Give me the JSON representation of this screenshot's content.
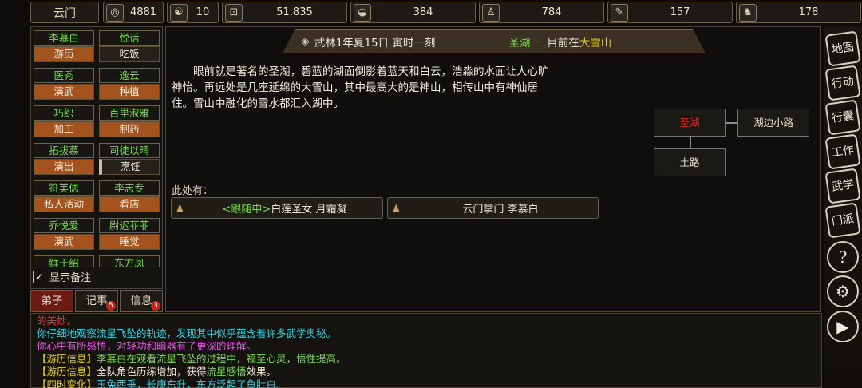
{
  "topbar": {
    "sect": "云门",
    "resources": [
      {
        "icon": "coin-pouch-icon",
        "glyph": "◎",
        "value": "4881"
      },
      {
        "icon": "yin-yang-icon",
        "glyph": "☯",
        "value": "10"
      },
      {
        "icon": "copper-coin-icon",
        "glyph": "⊡",
        "value": "51,835"
      },
      {
        "icon": "food-bowl-icon",
        "glyph": "◒",
        "value": "384"
      },
      {
        "icon": "herb-gourd-icon",
        "glyph": "♙",
        "value": "784"
      },
      {
        "icon": "scroll-icon",
        "glyph": "✎",
        "value": "157"
      },
      {
        "icon": "horse-icon",
        "glyph": "♞",
        "value": "178"
      }
    ]
  },
  "disciples": [
    {
      "name": "李慕白",
      "action": "游历",
      "style": "orange"
    },
    {
      "name": "悦话",
      "action": "吃饭",
      "style": "dark"
    },
    {
      "name": "医秀",
      "action": "演武",
      "style": "orange"
    },
    {
      "name": "逸云",
      "action": "种植",
      "style": "orange"
    },
    {
      "name": "巧织",
      "action": "加工",
      "style": "orange"
    },
    {
      "name": "百里淑雅",
      "action": "制药",
      "style": "orange"
    },
    {
      "name": "拓拔慕",
      "action": "演出",
      "style": "orange"
    },
    {
      "name": "司徒以晴",
      "action": "烹饪",
      "style": "dark"
    },
    {
      "name": "符美偲",
      "action": "私人活动",
      "style": "orange"
    },
    {
      "name": "李志专",
      "action": "看店",
      "style": "orange"
    },
    {
      "name": "乔悦爱",
      "action": "演武",
      "style": "orange"
    },
    {
      "name": "尉迟菲菲",
      "action": "睡觉",
      "style": "orange"
    },
    {
      "name": "鲜于绍",
      "action": "",
      "style": "orange"
    },
    {
      "name": "东方凤",
      "action": "",
      "style": "orange"
    }
  ],
  "show_notes_label": "显示备注",
  "tabs": [
    {
      "label": "弟子",
      "badge": ""
    },
    {
      "label": "记事",
      "badge": "5"
    },
    {
      "label": "信息",
      "badge": "3"
    }
  ],
  "location": {
    "date": "武林1年夏15日 寅时一刻",
    "place": "圣湖",
    "sep": "-",
    "current_prefix": "目前在",
    "region": "大雪山"
  },
  "description": "眼前就是著名的圣湖，碧蓝的湖面倒影着蓝天和白云，浩淼的水面让人心旷神怡。再远处是几座延绵的大雪山，其中最高大的是神山，相传山中有神仙居住。雪山中融化的雪水都汇入湖中。",
  "map": {
    "current": "圣湖",
    "east": "湖边小路",
    "south": "土路"
  },
  "here_label": "此处有：",
  "npcs": [
    {
      "tag": "<跟随中>",
      "name": "白莲圣女 月霜凝"
    },
    {
      "tag": "",
      "name": "云门掌门 李慕白"
    }
  ],
  "log": [
    [
      {
        "c": "c-red",
        "t": "的美妙。"
      }
    ],
    [
      {
        "c": "c-cyan",
        "t": "你仔细地观察流星飞坠的轨迹，发现其中似乎蕴含着许多武学奥秘。"
      }
    ],
    [
      {
        "c": "c-pink",
        "t": "你心中有所感悟，对轻功和暗器有了更深的理解。"
      }
    ],
    [
      {
        "c": "c-yel",
        "t": "【游历信息】"
      },
      {
        "c": "c-grn",
        "t": "李慕白在观看流星飞坠的过程中，福至心灵，悟性提高。"
      }
    ],
    [
      {
        "c": "c-yel",
        "t": "【游历信息】"
      },
      {
        "c": "c-wht",
        "t": "全队角色历练增加，获得"
      },
      {
        "c": "c-grn",
        "t": "流星感悟"
      },
      {
        "c": "c-wht",
        "t": "效果。"
      }
    ],
    [
      {
        "c": "c-yel",
        "t": "【四时变化】"
      },
      {
        "c": "c-cyan",
        "t": "玉兔西垂，长庚东升，东方泛起了鱼肚白。"
      }
    ]
  ],
  "side_buttons": [
    {
      "name": "map-button",
      "label": "地图"
    },
    {
      "name": "action-button",
      "label": "行动"
    },
    {
      "name": "bag-button",
      "label": "行囊"
    },
    {
      "name": "work-button",
      "label": "工作"
    },
    {
      "name": "martial-button",
      "label": "武学"
    },
    {
      "name": "sect-button",
      "label": "门派"
    },
    {
      "name": "help-button",
      "label": "?"
    },
    {
      "name": "settings-button",
      "label": "⚙"
    },
    {
      "name": "play-button",
      "label": "▶"
    }
  ]
}
